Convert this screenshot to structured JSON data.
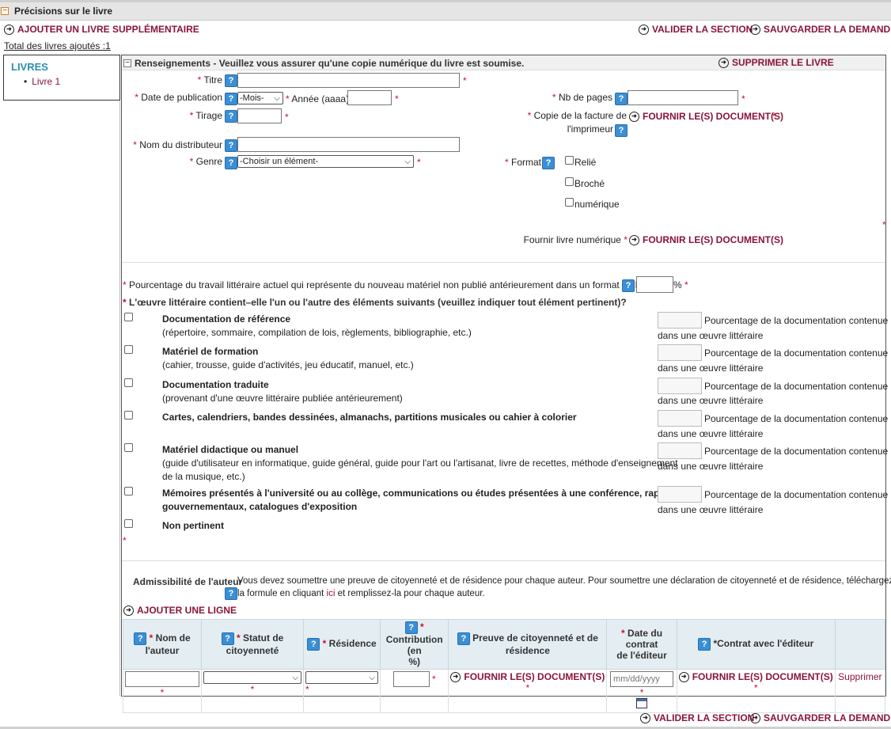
{
  "section": {
    "title": "Précisions sur le livre",
    "collapse": "−"
  },
  "toolbar": {
    "add_book": "AJOUTER UN LIVRE SUPPLÉMENTAIRE",
    "validate": "VALIDER LA SECTION",
    "save": "SAUVGARDER LA DEMANDE",
    "total": "Total des livres ajoutés :1"
  },
  "sidebar": {
    "title": "LIVRES",
    "items": [
      {
        "label": "Livre 1"
      }
    ]
  },
  "panel": {
    "title": "Renseignements - Veuillez vous assurer qu'une copie numérique du livre est soumise.",
    "delete_book": "SUPPRIMER LE LIVRE"
  },
  "form": {
    "titre": "Titre",
    "date_pub": "Date de publication",
    "mois": "-Mois-",
    "annee": "Année (aaaa)",
    "tirage": "Tirage",
    "distributeur": "Nom du distributeur",
    "genre": "Genre",
    "genre_value": "-Choisir un élément-",
    "nb_pages": "Nb de pages",
    "copie_facture_1": "Copie de la facture de",
    "copie_facture_2": "l'imprimeur",
    "fournir_docs": "FOURNIR LE(S) DOCUMENT(S)",
    "format": "Format",
    "format_options": [
      "Relié",
      "Broché",
      "numérique"
    ],
    "fournir_livre": "Fournir livre numérique"
  },
  "content": {
    "pourcentage_q": "Pourcentage du travail littéraire actuel qui représente du nouveau matériel non publié antérieurement dans un format de livre",
    "pct_sign": "%",
    "oeuvre_q": "L'œuvre littéraire contient–elle l'un ou l'autre des éléments suivants (veuillez indiquer tout élément pertinent)?",
    "pct_label_1": "Pourcentage de la documentation contenue",
    "pct_label_2": "dans une œuvre littéraire",
    "items": [
      {
        "title": "Documentation de référence",
        "desc": "(répertoire, sommaire, compilation de lois, règlements, bibliographie, etc.)"
      },
      {
        "title": "Matériel de formation",
        "desc": "(cahier, trousse, guide d'activités, jeu éducatif, manuel, etc.)"
      },
      {
        "title": "Documentation traduite",
        "desc": "(provenant d'une œuvre littéraire publiée antérieurement)"
      },
      {
        "title": "Cartes, calendriers, bandes dessinées, almanachs, partitions musicales ou cahier à colorier"
      },
      {
        "title": "Matériel didactique ou manuel",
        "desc": "(guide d'utilisateur en informatique, guide général, guide pour l'art ou l'artisanat, livre de recettes, méthode d'enseignement",
        "desc2": "de la musique, etc.)"
      },
      {
        "title": "Mémoires présentés à l'université ou au collège, communications ou études présentées à une conférence, rapports",
        "desc_bold": "gouvernementaux, catalogues d'exposition"
      },
      {
        "title": "Non pertinent"
      }
    ]
  },
  "author": {
    "label": "Admissibilité de l'auteur",
    "text1": "Vous devez soumettre une preuve de citoyenneté et de résidence pour chaque auteur. Pour soumettre une déclaration de citoyenneté et de résidence, téléchargez",
    "text2a": "la formule en cliquant ",
    "link": "ici",
    "text2b": " et remplissez-la pour chaque auteur.",
    "add_row": "AJOUTER UNE LIGNE",
    "headers": {
      "nom_1": "Nom de",
      "nom_2": "l'auteur",
      "statut_1": "Statut de",
      "statut_2": "citoyenneté",
      "residence": "Résidence",
      "contrib_1": "Contribution (en",
      "contrib_2": "%)",
      "preuve_1": "Preuve de citoyenneté et de",
      "preuve_2": "résidence",
      "date_1": "Date du contrat",
      "date_2": "de l'éditeur",
      "contrat": "*Contrat avec l'éditeur"
    },
    "date_placeholder": "mm/dd/yyyy",
    "supprimer": "Supprimer"
  }
}
